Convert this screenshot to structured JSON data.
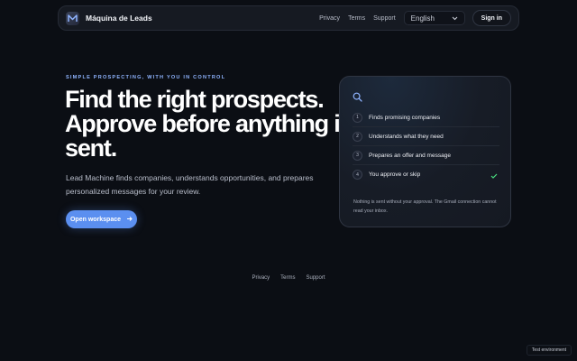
{
  "nav": {
    "brand": "Máquina de Leads",
    "links": [
      "Privacy",
      "Terms",
      "Support"
    ],
    "language": "English",
    "signin": "Sign in",
    "logo_icon": "m-logo-icon"
  },
  "hero": {
    "eyebrow": "SIMPLE PROSPECTING, WITH YOU IN CONTROL",
    "headline_lines": [
      "Find the right prospects.",
      "Approve before anything is",
      "sent."
    ],
    "subtitle": "Lead Machine finds companies, understands opportunities, and prepares personalized messages for your review.",
    "cta": "Open workspace",
    "cta_icon": "arrow-right-icon"
  },
  "card": {
    "icon": "search-icon",
    "steps": [
      {
        "num": "1",
        "label": "Finds promising companies"
      },
      {
        "num": "2",
        "label": "Understands what they need"
      },
      {
        "num": "3",
        "label": "Prepares an offer and message"
      },
      {
        "num": "4",
        "label": "You approve or skip"
      }
    ],
    "note": "Nothing is sent without your approval. The Gmail connection cannot read your inbox."
  },
  "footer": {
    "links": [
      "Privacy",
      "Terms",
      "Support"
    ]
  },
  "env_badge": "Test environment",
  "colors": {
    "background": "#0b0e14",
    "accent": "#5b8ff0",
    "eyebrow": "#8fb4ff",
    "check": "#4ade80"
  }
}
